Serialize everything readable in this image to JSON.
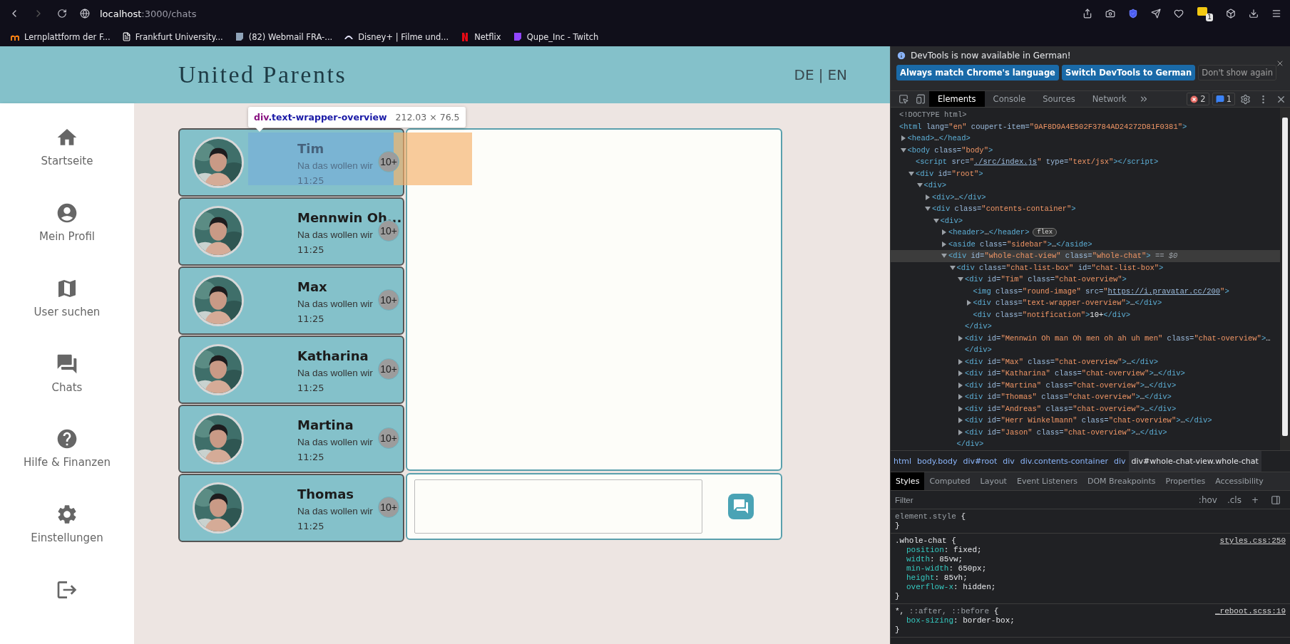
{
  "browser": {
    "url": {
      "host": "localhost",
      "path": ":3000/chats"
    },
    "extension_badge": "1",
    "bookmarks": [
      {
        "label": "Lernplattform der F..."
      },
      {
        "label": "Frankfurt University..."
      },
      {
        "label": "(82) Webmail FRA-..."
      },
      {
        "label": "Disney+ | Filme und..."
      },
      {
        "label": "Netflix"
      },
      {
        "label": "Qupe_Inc - Twitch"
      }
    ]
  },
  "app": {
    "title": "United Parents",
    "languages": [
      {
        "label": "DE"
      },
      {
        "label": "EN"
      }
    ],
    "language_separator": "|",
    "sidebar": {
      "items": [
        {
          "label": "Startseite"
        },
        {
          "label": "Mein Profil"
        },
        {
          "label": "User suchen"
        },
        {
          "label": "Chats"
        },
        {
          "label": "Hilfe & Finanzen"
        },
        {
          "label": "Einstellungen"
        }
      ]
    },
    "chats": [
      {
        "name": "Tim",
        "preview": "Na das wollen wir",
        "time": "11:25",
        "badge": "10+"
      },
      {
        "name": "Mennwin Oh...",
        "preview": "Na das wollen wir",
        "time": "11:25",
        "badge": "10+"
      },
      {
        "name": "Max",
        "preview": "Na das wollen wir",
        "time": "11:25",
        "badge": "10+"
      },
      {
        "name": "Katharina",
        "preview": "Na das wollen wir",
        "time": "11:25",
        "badge": "10+"
      },
      {
        "name": "Martina",
        "preview": "Na das wollen wir",
        "time": "11:25",
        "badge": "10+"
      },
      {
        "name": "Thomas",
        "preview": "Na das wollen wir",
        "time": "11:25",
        "badge": "10+"
      }
    ],
    "inspector_tooltip": {
      "tag": "div",
      "class": ".text-wrapper-overview",
      "size": "212.03 × 76.5"
    }
  },
  "devtools": {
    "notice": {
      "text": "DevTools is now available in German!",
      "buttons": [
        {
          "label": "Always match Chrome's language",
          "kind": "primary"
        },
        {
          "label": "Switch DevTools to German",
          "kind": "primary"
        },
        {
          "label": "Don't show again",
          "kind": "secondary"
        }
      ]
    },
    "tabs": [
      {
        "label": "Elements",
        "selected": true
      },
      {
        "label": "Console",
        "selected": false
      },
      {
        "label": "Sources",
        "selected": false
      },
      {
        "label": "Network",
        "selected": false
      }
    ],
    "errors": "2",
    "messages": "1",
    "dom_tree": [
      {
        "open": [
          {
            "kind": "doctype",
            "text": "<!DOCTYPE html>"
          }
        ],
        "selected": false
      },
      {
        "open": [
          {
            "kind": "tag",
            "text": "<html"
          },
          {
            "kind": "attr",
            "text": " lang="
          },
          {
            "kind": "value",
            "text": "\"en\""
          },
          {
            "kind": "attr",
            "text": " coupert-item="
          },
          {
            "kind": "value",
            "text": "\"9AF8D9A4E502F3784AD24272D81F0381\""
          },
          {
            "kind": "tag",
            "text": ">"
          }
        ],
        "selected": false,
        "children": [
          {
            "open": [
              {
                "kind": "tag",
                "text": "<head>"
              },
              {
                "kind": "text",
                "text": "…"
              },
              {
                "kind": "tag",
                "text": "</head>"
              }
            ],
            "expanded": false,
            "selected": false
          },
          {
            "open": [
              {
                "kind": "tag",
                "text": "<body"
              },
              {
                "kind": "attr",
                "text": " class="
              },
              {
                "kind": "value",
                "text": "\"body\""
              },
              {
                "kind": "tag",
                "text": ">"
              }
            ],
            "expanded": true,
            "selected": false,
            "children": [
              {
                "open": [
                  {
                    "kind": "tag",
                    "text": "<script"
                  },
                  {
                    "kind": "attr",
                    "text": " src="
                  },
                  {
                    "kind": "value",
                    "text": "\""
                  },
                  {
                    "kind": "link",
                    "text": "./src/index.js"
                  },
                  {
                    "kind": "value",
                    "text": "\""
                  },
                  {
                    "kind": "attr",
                    "text": " type="
                  },
                  {
                    "kind": "value",
                    "text": "\"text/jsx\""
                  },
                  {
                    "kind": "tag",
                    "text": "></script>"
                  }
                ],
                "selected": false
              },
              {
                "open": [
                  {
                    "kind": "tag",
                    "text": "<div"
                  },
                  {
                    "kind": "attr",
                    "text": " id="
                  },
                  {
                    "kind": "value",
                    "text": "\"root\""
                  },
                  {
                    "kind": "tag",
                    "text": ">"
                  }
                ],
                "expanded": true,
                "selected": false,
                "children": [
                  {
                    "open": [
                      {
                        "kind": "tag",
                        "text": "<div>"
                      }
                    ],
                    "expanded": true,
                    "selected": false,
                    "children": [
                      {
                        "open": [
                          {
                            "kind": "tag",
                            "text": "<div>"
                          },
                          {
                            "kind": "text",
                            "text": "…"
                          },
                          {
                            "kind": "tag",
                            "text": "</div>"
                          }
                        ],
                        "expanded": false,
                        "selected": false
                      },
                      {
                        "open": [
                          {
                            "kind": "tag",
                            "text": "<div"
                          },
                          {
                            "kind": "attr",
                            "text": " class="
                          },
                          {
                            "kind": "value",
                            "text": "\"contents-container\""
                          },
                          {
                            "kind": "tag",
                            "text": ">"
                          }
                        ],
                        "expanded": true,
                        "selected": false,
                        "children": [
                          {
                            "open": [
                              {
                                "kind": "tag",
                                "text": "<div>"
                              }
                            ],
                            "expanded": true,
                            "selected": false,
                            "children": [
                              {
                                "open": [
                                  {
                                    "kind": "tag",
                                    "text": "<header>"
                                  },
                                  {
                                    "kind": "text",
                                    "text": "…"
                                  },
                                  {
                                    "kind": "tag",
                                    "text": "</header>"
                                  },
                                  {
                                    "kind": "badge",
                                    "text": "flex"
                                  }
                                ],
                                "expanded": false,
                                "selected": false
                              },
                              {
                                "open": [
                                  {
                                    "kind": "tag",
                                    "text": "<aside"
                                  },
                                  {
                                    "kind": "attr",
                                    "text": " class="
                                  },
                                  {
                                    "kind": "value",
                                    "text": "\"sidebar\""
                                  },
                                  {
                                    "kind": "tag",
                                    "text": ">"
                                  },
                                  {
                                    "kind": "text",
                                    "text": "…"
                                  },
                                  {
                                    "kind": "tag",
                                    "text": "</aside>"
                                  }
                                ],
                                "expanded": false,
                                "selected": false
                              },
                              {
                                "open": [
                                  {
                                    "kind": "tag",
                                    "text": "<div"
                                  },
                                  {
                                    "kind": "attr",
                                    "text": " id="
                                  },
                                  {
                                    "kind": "value",
                                    "text": "\"whole-chat-view\""
                                  },
                                  {
                                    "kind": "attr",
                                    "text": " class="
                                  },
                                  {
                                    "kind": "value",
                                    "text": "\"whole-chat\""
                                  },
                                  {
                                    "kind": "tag",
                                    "text": ">"
                                  },
                                  {
                                    "kind": "dim",
                                    "text": " == $0"
                                  }
                                ],
                                "expanded": true,
                                "selected": true,
                                "children": [
                                  {
                                    "open": [
                                      {
                                        "kind": "tag",
                                        "text": "<div"
                                      },
                                      {
                                        "kind": "attr",
                                        "text": " class="
                                      },
                                      {
                                        "kind": "value",
                                        "text": "\"chat-list-box\""
                                      },
                                      {
                                        "kind": "attr",
                                        "text": " id="
                                      },
                                      {
                                        "kind": "value",
                                        "text": "\"chat-list-box\""
                                      },
                                      {
                                        "kind": "tag",
                                        "text": ">"
                                      }
                                    ],
                                    "expanded": true,
                                    "selected": false,
                                    "closing": [
                                      {
                                        "kind": "tag",
                                        "text": "</div>"
                                      }
                                    ],
                                    "children": [
                                      {
                                        "open": [
                                          {
                                            "kind": "tag",
                                            "text": "<div"
                                          },
                                          {
                                            "kind": "attr",
                                            "text": " id="
                                          },
                                          {
                                            "kind": "value",
                                            "text": "\"Tim\""
                                          },
                                          {
                                            "kind": "attr",
                                            "text": " class="
                                          },
                                          {
                                            "kind": "value",
                                            "text": "\"chat-overview\""
                                          },
                                          {
                                            "kind": "tag",
                                            "text": ">"
                                          }
                                        ],
                                        "expanded": true,
                                        "selected": false,
                                        "closing": [
                                          {
                                            "kind": "tag",
                                            "text": "</div>"
                                          }
                                        ],
                                        "children": [
                                          {
                                            "open": [
                                              {
                                                "kind": "tag",
                                                "text": "<img"
                                              },
                                              {
                                                "kind": "attr",
                                                "text": " class="
                                              },
                                              {
                                                "kind": "value",
                                                "text": "\"round-image\""
                                              },
                                              {
                                                "kind": "attr",
                                                "text": " src="
                                              },
                                              {
                                                "kind": "value",
                                                "text": "\""
                                              },
                                              {
                                                "kind": "link",
                                                "text": "https://i.pravatar.cc/200"
                                              },
                                              {
                                                "kind": "value",
                                                "text": "\""
                                              },
                                              {
                                                "kind": "tag",
                                                "text": ">"
                                              }
                                            ],
                                            "selected": false
                                          },
                                          {
                                            "open": [
                                              {
                                                "kind": "tag",
                                                "text": "<div"
                                              },
                                              {
                                                "kind": "attr",
                                                "text": " class="
                                              },
                                              {
                                                "kind": "value",
                                                "text": "\"text-wrapper-overview\""
                                              },
                                              {
                                                "kind": "tag",
                                                "text": ">"
                                              },
                                              {
                                                "kind": "text",
                                                "text": "…"
                                              },
                                              {
                                                "kind": "tag",
                                                "text": "</div>"
                                              }
                                            ],
                                            "expanded": false,
                                            "selected": false
                                          },
                                          {
                                            "open": [
                                              {
                                                "kind": "tag",
                                                "text": "<div"
                                              },
                                              {
                                                "kind": "attr",
                                                "text": " class="
                                              },
                                              {
                                                "kind": "value",
                                                "text": "\"notification\""
                                              },
                                              {
                                                "kind": "tag",
                                                "text": ">"
                                              },
                                              {
                                                "kind": "text",
                                                "text": "10+"
                                              },
                                              {
                                                "kind": "tag",
                                                "text": "</div>"
                                              }
                                            ],
                                            "selected": false
                                          }
                                        ]
                                      },
                                      {
                                        "open": [
                                          {
                                            "kind": "tag",
                                            "text": "<div"
                                          },
                                          {
                                            "kind": "attr",
                                            "text": " id="
                                          },
                                          {
                                            "kind": "value",
                                            "text": "\"Mennwin Oh man Oh men oh ah uh men\""
                                          },
                                          {
                                            "kind": "attr",
                                            "text": " class="
                                          },
                                          {
                                            "kind": "value",
                                            "text": "\"chat-overview\""
                                          },
                                          {
                                            "kind": "tag",
                                            "text": ">"
                                          },
                                          {
                                            "kind": "text",
                                            "text": "…"
                                          }
                                        ],
                                        "expanded": false,
                                        "selected": false,
                                        "closing": [
                                          {
                                            "kind": "tag",
                                            "text": "</div>"
                                          }
                                        ]
                                      },
                                      {
                                        "open": [
                                          {
                                            "kind": "tag",
                                            "text": "<div"
                                          },
                                          {
                                            "kind": "attr",
                                            "text": " id="
                                          },
                                          {
                                            "kind": "value",
                                            "text": "\"Max\""
                                          },
                                          {
                                            "kind": "attr",
                                            "text": " class="
                                          },
                                          {
                                            "kind": "value",
                                            "text": "\"chat-overview\""
                                          },
                                          {
                                            "kind": "tag",
                                            "text": ">"
                                          },
                                          {
                                            "kind": "text",
                                            "text": "…"
                                          },
                                          {
                                            "kind": "tag",
                                            "text": "</div>"
                                          }
                                        ],
                                        "expanded": false,
                                        "selected": false
                                      },
                                      {
                                        "open": [
                                          {
                                            "kind": "tag",
                                            "text": "<div"
                                          },
                                          {
                                            "kind": "attr",
                                            "text": " id="
                                          },
                                          {
                                            "kind": "value",
                                            "text": "\"Katharina\""
                                          },
                                          {
                                            "kind": "attr",
                                            "text": " class="
                                          },
                                          {
                                            "kind": "value",
                                            "text": "\"chat-overview\""
                                          },
                                          {
                                            "kind": "tag",
                                            "text": ">"
                                          },
                                          {
                                            "kind": "text",
                                            "text": "…"
                                          },
                                          {
                                            "kind": "tag",
                                            "text": "</div>"
                                          }
                                        ],
                                        "expanded": false,
                                        "selected": false
                                      },
                                      {
                                        "open": [
                                          {
                                            "kind": "tag",
                                            "text": "<div"
                                          },
                                          {
                                            "kind": "attr",
                                            "text": " id="
                                          },
                                          {
                                            "kind": "value",
                                            "text": "\"Martina\""
                                          },
                                          {
                                            "kind": "attr",
                                            "text": " class="
                                          },
                                          {
                                            "kind": "value",
                                            "text": "\"chat-overview\""
                                          },
                                          {
                                            "kind": "tag",
                                            "text": ">"
                                          },
                                          {
                                            "kind": "text",
                                            "text": "…"
                                          },
                                          {
                                            "kind": "tag",
                                            "text": "</div>"
                                          }
                                        ],
                                        "expanded": false,
                                        "selected": false
                                      },
                                      {
                                        "open": [
                                          {
                                            "kind": "tag",
                                            "text": "<div"
                                          },
                                          {
                                            "kind": "attr",
                                            "text": " id="
                                          },
                                          {
                                            "kind": "value",
                                            "text": "\"Thomas\""
                                          },
                                          {
                                            "kind": "attr",
                                            "text": " class="
                                          },
                                          {
                                            "kind": "value",
                                            "text": "\"chat-overview\""
                                          },
                                          {
                                            "kind": "tag",
                                            "text": ">"
                                          },
                                          {
                                            "kind": "text",
                                            "text": "…"
                                          },
                                          {
                                            "kind": "tag",
                                            "text": "</div>"
                                          }
                                        ],
                                        "expanded": false,
                                        "selected": false
                                      },
                                      {
                                        "open": [
                                          {
                                            "kind": "tag",
                                            "text": "<div"
                                          },
                                          {
                                            "kind": "attr",
                                            "text": " id="
                                          },
                                          {
                                            "kind": "value",
                                            "text": "\"Andreas\""
                                          },
                                          {
                                            "kind": "attr",
                                            "text": " class="
                                          },
                                          {
                                            "kind": "value",
                                            "text": "\"chat-overview\""
                                          },
                                          {
                                            "kind": "tag",
                                            "text": ">"
                                          },
                                          {
                                            "kind": "text",
                                            "text": "…"
                                          },
                                          {
                                            "kind": "tag",
                                            "text": "</div>"
                                          }
                                        ],
                                        "expanded": false,
                                        "selected": false
                                      },
                                      {
                                        "open": [
                                          {
                                            "kind": "tag",
                                            "text": "<div"
                                          },
                                          {
                                            "kind": "attr",
                                            "text": " id="
                                          },
                                          {
                                            "kind": "value",
                                            "text": "\"Herr Winkelmann\""
                                          },
                                          {
                                            "kind": "attr",
                                            "text": " class="
                                          },
                                          {
                                            "kind": "value",
                                            "text": "\"chat-overview\""
                                          },
                                          {
                                            "kind": "tag",
                                            "text": ">"
                                          },
                                          {
                                            "kind": "text",
                                            "text": "…"
                                          },
                                          {
                                            "kind": "tag",
                                            "text": "</div>"
                                          }
                                        ],
                                        "expanded": false,
                                        "selected": false
                                      },
                                      {
                                        "open": [
                                          {
                                            "kind": "tag",
                                            "text": "<div"
                                          },
                                          {
                                            "kind": "attr",
                                            "text": " id="
                                          },
                                          {
                                            "kind": "value",
                                            "text": "\"Jason\""
                                          },
                                          {
                                            "kind": "attr",
                                            "text": " class="
                                          },
                                          {
                                            "kind": "value",
                                            "text": "\"chat-overview\""
                                          },
                                          {
                                            "kind": "tag",
                                            "text": ">"
                                          },
                                          {
                                            "kind": "text",
                                            "text": "…"
                                          },
                                          {
                                            "kind": "tag",
                                            "text": "</div>"
                                          }
                                        ],
                                        "expanded": false,
                                        "selected": false
                                      }
                                    ]
                                  }
                                ]
                              }
                            ]
                          }
                        ]
                      }
                    ]
                  }
                ]
              }
            ]
          }
        ]
      }
    ],
    "breadcrumbs": [
      {
        "label": "html",
        "selected": false
      },
      {
        "label": "body.body",
        "selected": false
      },
      {
        "label": "div#root",
        "selected": false
      },
      {
        "label": "div",
        "selected": false
      },
      {
        "label": "div.contents-container",
        "selected": false
      },
      {
        "label": "div",
        "selected": false
      },
      {
        "label": "div#whole-chat-view.whole-chat",
        "selected": true
      }
    ],
    "style_tabs": [
      {
        "label": "Styles",
        "selected": true
      },
      {
        "label": "Computed",
        "selected": false
      },
      {
        "label": "Layout",
        "selected": false
      },
      {
        "label": "Event Listeners",
        "selected": false
      },
      {
        "label": "DOM Breakpoints",
        "selected": false
      },
      {
        "label": "Properties",
        "selected": false
      },
      {
        "label": "Accessibility",
        "selected": false
      }
    ],
    "filter": {
      "placeholder": "Filter"
    },
    "filter_buttons": [
      ":hov",
      ".cls",
      "+"
    ],
    "rules": [
      {
        "selector": [
          {
            "text": "element.style",
            "dim": true
          }
        ],
        "open": "{",
        "close": "}"
      },
      {
        "selector": [
          {
            "text": ".whole-chat",
            "dim": false
          }
        ],
        "open": "{",
        "close": "}",
        "source": "styles.css:250",
        "declarations": [
          {
            "property": "position",
            "value": ": fixed;"
          },
          {
            "property": "width",
            "value": ": 85vw;"
          },
          {
            "property": "min-width",
            "value": ": 650px;"
          },
          {
            "property": "height",
            "value": ": 85vh;"
          },
          {
            "property": "overflow-x",
            "value": ": hidden;"
          }
        ]
      },
      {
        "selector": [
          {
            "text": "*,",
            "dim": false
          },
          {
            "text": " ::after, ::before",
            "dim": true
          }
        ],
        "open": "{",
        "close": "}",
        "source": "_reboot.scss:19",
        "declarations": [
          {
            "property": "box-sizing",
            "value": ": border-box;"
          }
        ]
      }
    ]
  }
}
